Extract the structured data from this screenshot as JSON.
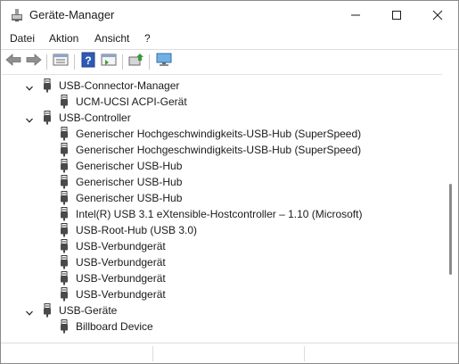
{
  "window": {
    "title": "Geräte-Manager",
    "icons": {
      "app": "device-manager-icon",
      "minimize": "minimize-icon",
      "maximize": "maximize-icon",
      "close": "close-icon"
    }
  },
  "menu": [
    "Datei",
    "Aktion",
    "Ansicht",
    "?"
  ],
  "toolbar": {
    "buttons": [
      "back-arrow-icon",
      "forward-arrow-icon",
      "properties-sheet-icon",
      "help-icon",
      "view-pane-icon",
      "scan-hardware-icon",
      "monitor-icon"
    ]
  },
  "tree": [
    {
      "label": "USB-Connector-Manager",
      "level": 1,
      "expanded": true
    },
    {
      "label": "UCM-UCSI ACPI-Gerät",
      "level": 2
    },
    {
      "label": "USB-Controller",
      "level": 1,
      "expanded": true
    },
    {
      "label": "Generischer Hochgeschwindigkeits-USB-Hub (SuperSpeed)",
      "level": 2
    },
    {
      "label": "Generischer Hochgeschwindigkeits-USB-Hub (SuperSpeed)",
      "level": 2
    },
    {
      "label": "Generischer USB-Hub",
      "level": 2
    },
    {
      "label": "Generischer USB-Hub",
      "level": 2
    },
    {
      "label": "Generischer USB-Hub",
      "level": 2
    },
    {
      "label": "Intel(R) USB 3.1 eXtensible-Hostcontroller – 1.10 (Microsoft)",
      "level": 2
    },
    {
      "label": "USB-Root-Hub (USB 3.0)",
      "level": 2
    },
    {
      "label": "USB-Verbundgerät",
      "level": 2
    },
    {
      "label": "USB-Verbundgerät",
      "level": 2
    },
    {
      "label": "USB-Verbundgerät",
      "level": 2
    },
    {
      "label": "USB-Verbundgerät",
      "level": 2
    },
    {
      "label": "USB-Geräte",
      "level": 1,
      "expanded": true
    },
    {
      "label": "Billboard Device",
      "level": 2
    }
  ],
  "scrollbar": {
    "position": 0.62,
    "visible_fraction": 0.34
  }
}
